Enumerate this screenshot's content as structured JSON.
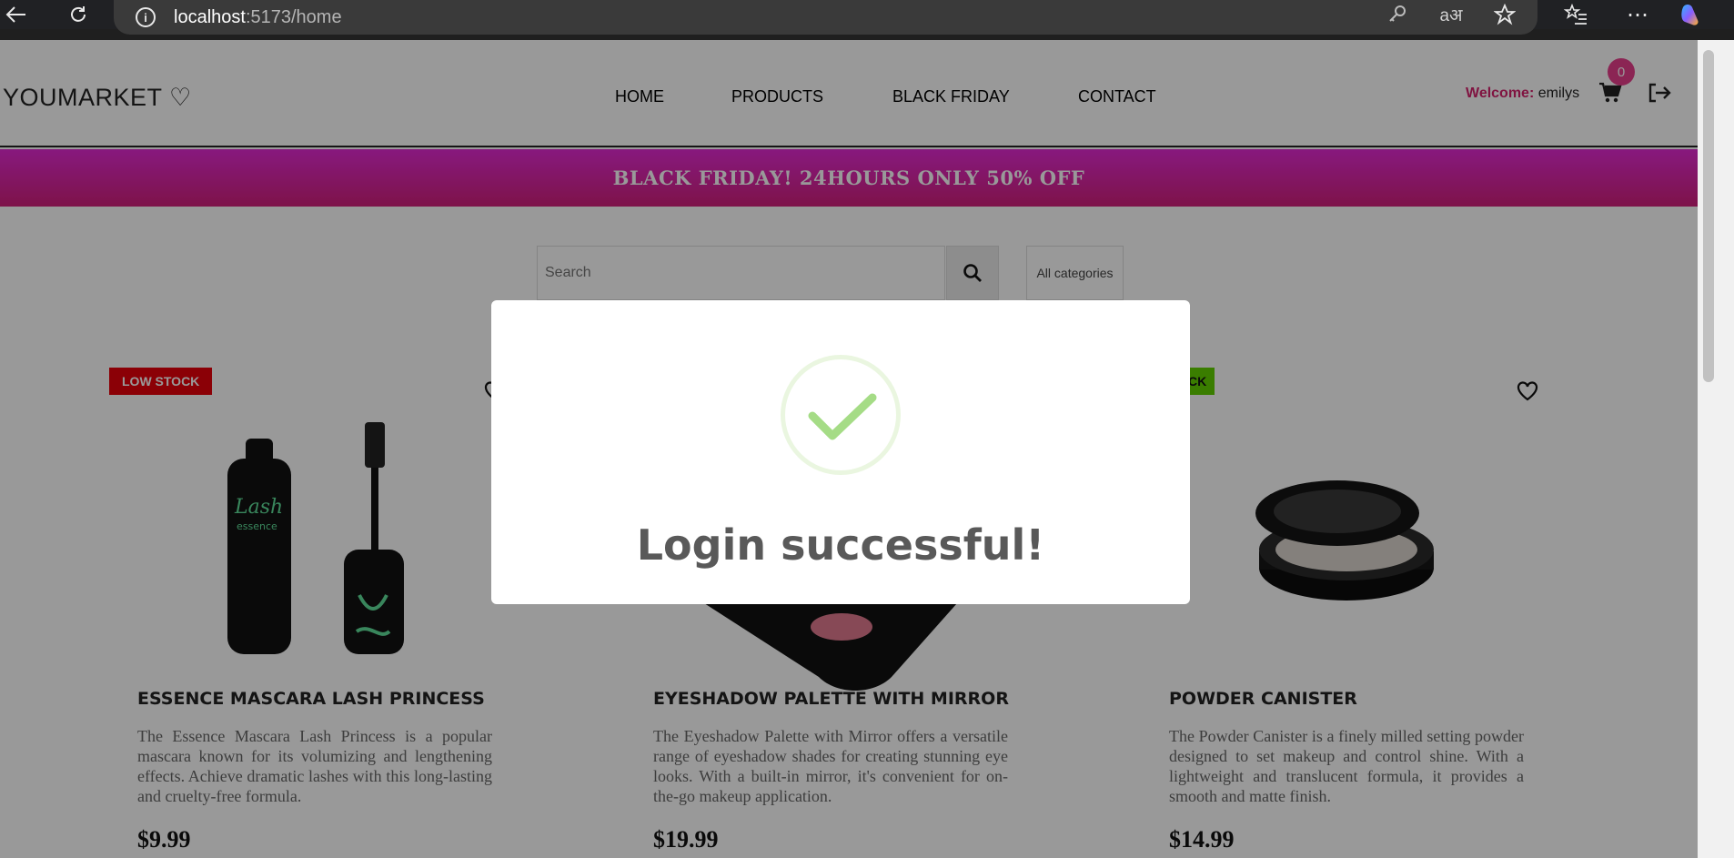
{
  "browser": {
    "url_host": "localhost",
    "url_path": ":5173/home"
  },
  "header": {
    "logo": "YOUMARKET ♡",
    "nav": [
      "HOME",
      "PRODUCTS",
      "BLACK FRIDAY",
      "CONTACT"
    ],
    "welcome_label": "Welcome:",
    "username": "emilys",
    "cart_count": "0"
  },
  "banner": {
    "text": "BLACK FRIDAY! 24HOURS ONLY 50% OFF"
  },
  "search": {
    "placeholder": "Search",
    "category": "All categories"
  },
  "products": [
    {
      "badge": "LOW STOCK",
      "badge_color": "#e8000b",
      "title": "ESSENCE MASCARA LASH PRINCESS",
      "description": "The Essence Mascara Lash Princess is a popular mascara known for its volumizing and lengthening effects. Achieve dramatic lashes with this long-lasting and cruelty-free formula.",
      "price": "$9.99"
    },
    {
      "badge": "",
      "badge_color": "",
      "title": "EYESHADOW PALETTE WITH MIRROR",
      "description": "The Eyeshadow Palette with Mirror offers a versatile range of eyeshadow shades for creating stunning eye looks. With a built-in mirror, it's convenient for on-the-go makeup application.",
      "price": "$19.99"
    },
    {
      "badge": "CK",
      "badge_color": "#62d100",
      "title": "POWDER CANISTER",
      "description": "The Powder Canister is a finely milled setting powder designed to set makeup and control shine. With a lightweight and translucent formula, it provides a smooth and matte finish.",
      "price": "$14.99"
    }
  ],
  "modal": {
    "title": "Login successful!"
  },
  "colors": {
    "accent": "#e83e8c",
    "success": "#a5dc86"
  }
}
